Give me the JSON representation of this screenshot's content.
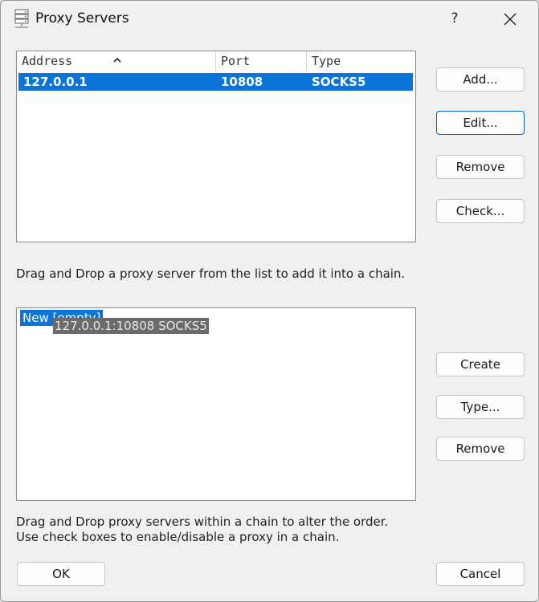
{
  "window": {
    "title": "Proxy Servers",
    "help_label": "?"
  },
  "servers": {
    "columns": [
      "Address",
      "Port",
      "Type"
    ],
    "rows": [
      {
        "address": "127.0.0.1",
        "port": "10808",
        "type": "SOCKS5"
      }
    ]
  },
  "server_buttons": {
    "add": "Add...",
    "edit": "Edit...",
    "remove": "Remove",
    "check": "Check..."
  },
  "hint_servers": "Drag and Drop a proxy server from the list to add it into a chain.",
  "chains": {
    "items": [
      "New [empty]"
    ],
    "drag_preview": "127.0.0.1:10808 SOCKS5"
  },
  "chain_buttons": {
    "create": "Create",
    "type": "Type...",
    "remove": "Remove"
  },
  "hint_chains_line1": "Drag and Drop proxy servers within a chain to alter the order.",
  "hint_chains_line2": "Use check boxes to enable/disable a proxy in a chain.",
  "footer": {
    "ok": "OK",
    "cancel": "Cancel"
  },
  "colors": {
    "selection": "#0a74d9",
    "accent_border": "#0067c0",
    "window_bg": "#f0f0f0"
  }
}
